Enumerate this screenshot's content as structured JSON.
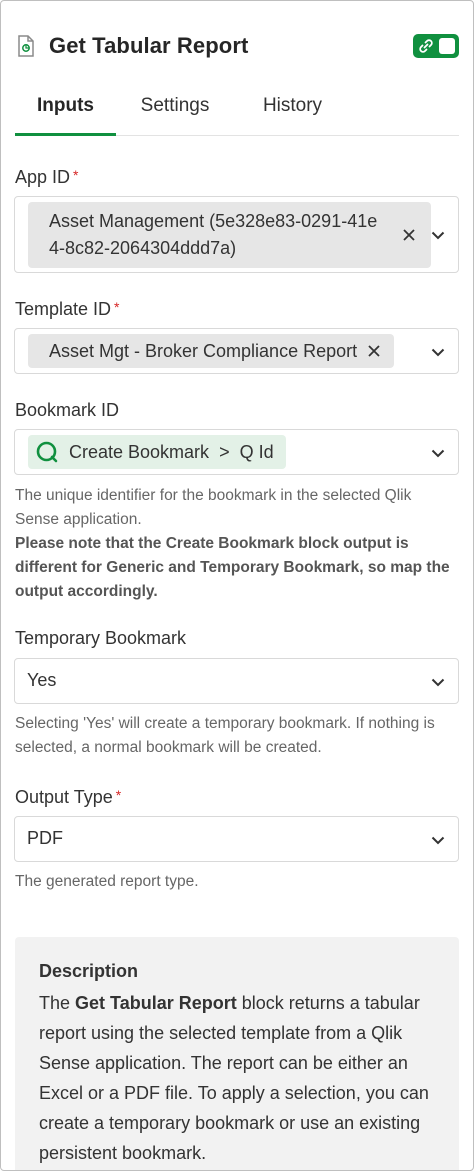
{
  "header": {
    "title": "Get Tabular Report",
    "toggle_on": true,
    "accent": "#10903f"
  },
  "tabs": [
    {
      "label": "Inputs",
      "active": true
    },
    {
      "label": "Settings",
      "active": false
    },
    {
      "label": "History",
      "active": false
    }
  ],
  "app_id": {
    "label": "App ID",
    "required": "*",
    "value_line1": "Asset Management (5e328e83-0291-41e",
    "value_line2": "4-8c82-2064304ddd7a)"
  },
  "template_id": {
    "label": "Template ID",
    "required": "*",
    "value": "Asset Mgt - Broker Compliance Report"
  },
  "bookmark_id": {
    "label": "Bookmark ID",
    "chip_block": "Create Bookmark",
    "chip_separator": ">",
    "chip_field": "Q Id",
    "help_text": "The unique identifier for the bookmark in the selected Qlik Sense application.",
    "help_note": "Please note that the Create Bookmark block output is different for Generic and Temporary Bookmark, so map the output accordingly."
  },
  "temporary_bookmark": {
    "label": "Temporary Bookmark",
    "value": "Yes",
    "help_text": "Selecting 'Yes' will create a temporary bookmark. If nothing is selected, a normal bookmark will be created."
  },
  "output_type": {
    "label": "Output Type",
    "required": "*",
    "value": "PDF",
    "help_text": "The generated report type."
  },
  "description": {
    "title": "Description",
    "text_prefix": "The ",
    "text_bold": "Get Tabular Report",
    "text_suffix": " block returns a tabular report using the selected template from a Qlik Sense application. The report can be either an Excel or a PDF file. To apply a selection, you can create a temporary bookmark or use an existing persistent bookmark."
  }
}
